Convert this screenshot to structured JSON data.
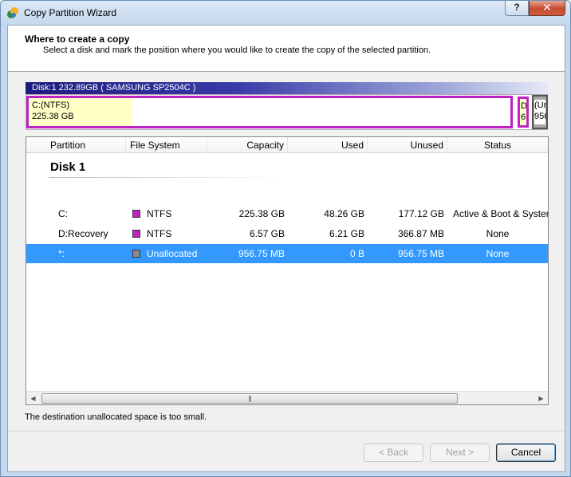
{
  "window": {
    "title": "Copy Partition Wizard",
    "help_label": "?",
    "close_label": "✕"
  },
  "header": {
    "title": "Where to create a copy",
    "subtitle": "Select a disk and mark the position where you would like to create the copy of the selected partition."
  },
  "disk": {
    "label": "Disk:1 232.89GB  ( SAMSUNG SP2504C )",
    "segments": {
      "c": {
        "name": "C:(NTFS)",
        "size": "225.38 GB"
      },
      "d": {
        "name": "D",
        "size": "6"
      },
      "u": {
        "name": "(Un",
        "size": "956"
      }
    }
  },
  "table": {
    "columns": [
      "Partition",
      "File System",
      "Capacity",
      "Used",
      "Unused",
      "Status"
    ],
    "group": "Disk 1",
    "rows": [
      {
        "partition": "C:",
        "fs": "NTFS",
        "capacity": "225.38 GB",
        "used": "48.26 GB",
        "unused": "177.12 GB",
        "status": "Active & Boot & System",
        "color": "#c221c6"
      },
      {
        "partition": "D:Recovery",
        "fs": "NTFS",
        "capacity": "6.57 GB",
        "used": "6.21 GB",
        "unused": "366.87 MB",
        "status": "None",
        "color": "#c221c6"
      },
      {
        "partition": "*:",
        "fs": "Unallocated",
        "capacity": "956.75 MB",
        "used": "0 B",
        "unused": "956.75 MB",
        "status": "None",
        "color": "#8a8a8a"
      }
    ],
    "scroll_grip": "|||"
  },
  "status_message": "The destination unallocated space is too small.",
  "buttons": {
    "back": "< Back",
    "next": "Next >",
    "cancel": "Cancel"
  },
  "colors": {
    "ntfs": "#c221c6",
    "selection": "#3399ff",
    "primary_segment": "#ffffc6"
  }
}
